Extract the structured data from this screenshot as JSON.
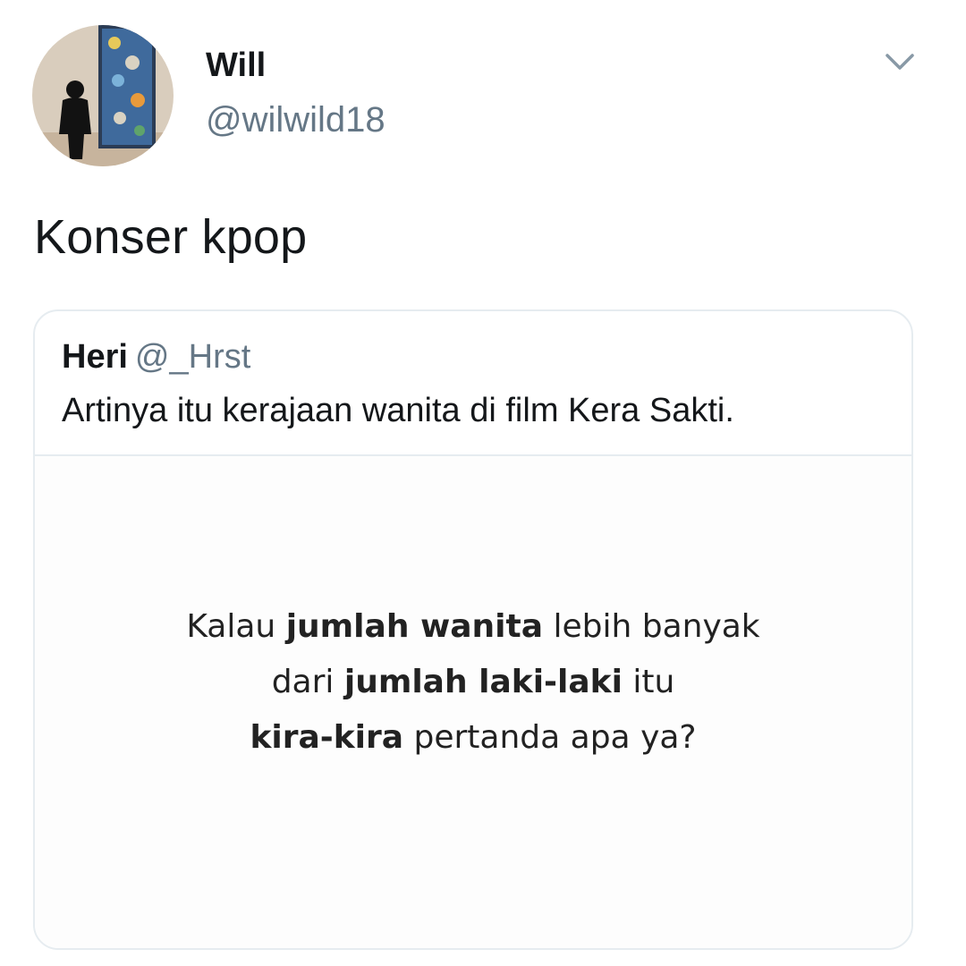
{
  "tweet": {
    "author": {
      "display_name": "Will",
      "handle": "@wilwild18",
      "avatar": "avatar-photo-person-viewing-painting"
    },
    "menu_icon": "chevron-down-icon",
    "text": "Konser kpop"
  },
  "quoted_tweet": {
    "author_name": "Heri",
    "author_handle": "@_Hrst",
    "text": "Artinya itu kerajaan wanita di film Kera Sakti.",
    "media": {
      "line1_a": "Kalau",
      "line1_b": "jumlah wanita",
      "line1_c": "lebih banyak",
      "line2_a": "dari",
      "line2_b": "jumlah laki-laki",
      "line2_c": "itu",
      "line3_a": "kira-kira",
      "line3_b": "pertanda apa ya?"
    }
  },
  "colors": {
    "text_primary": "#14171a",
    "text_secondary": "#657786",
    "border": "#e6ecf0"
  }
}
